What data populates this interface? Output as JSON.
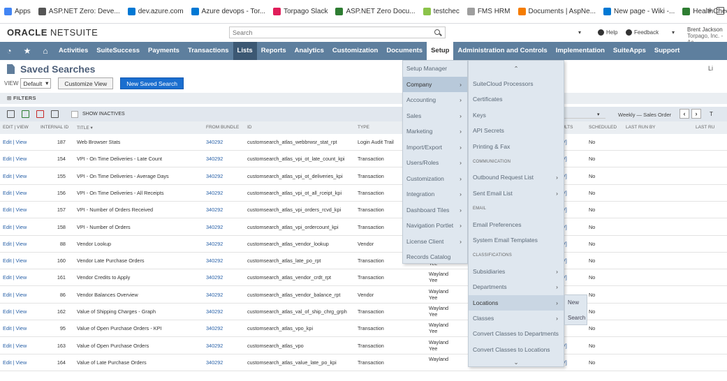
{
  "bookmarks": {
    "items": [
      {
        "label": "Apps",
        "color": "#4285f4"
      },
      {
        "label": "ASP.NET Zero: Deve...",
        "color": "#555555"
      },
      {
        "label": "dev.azure.com",
        "color": "#0078d4"
      },
      {
        "label": "Azure devops - Tor...",
        "color": "#0078d4"
      },
      {
        "label": "Torpago Slack",
        "color": "#e01e5a"
      },
      {
        "label": "ASP.NET Zero Docu...",
        "color": "#2e7d32"
      },
      {
        "label": "testchec",
        "color": "#8bc34a"
      },
      {
        "label": "FMS HRM",
        "color": "#9e9e9e"
      },
      {
        "label": "Documents | AspNe...",
        "color": "#f57c00"
      },
      {
        "label": "New page - Wiki -...",
        "color": "#0078d4"
      },
      {
        "label": "HealthChecks | ASP....",
        "color": "#2e7d32"
      }
    ],
    "more": "»"
  },
  "header": {
    "logo_bold": "ORACLE",
    "logo_light": " NETSUITE",
    "search_placeholder": "Search",
    "help": "Help",
    "feedback": "Feedback",
    "user_name": "Brent Jackson",
    "user_company": "Torpago, Inc. - Ac"
  },
  "nav": {
    "items": [
      "Activities",
      "SuiteSuccess",
      "Payments",
      "Transactions",
      "Lists",
      "Reports",
      "Analytics",
      "Customization",
      "Documents",
      "Setup",
      "Administration and Controls",
      "Implementation",
      "SuiteApps",
      "Support"
    ],
    "active": "Lists",
    "open": "Setup"
  },
  "page": {
    "title": "Saved Searches",
    "right_tab": "Li"
  },
  "toolbar": {
    "view_label": "VIEW",
    "view_value": "Default",
    "customize_label": "Customize View",
    "new_label": "New Saved Search"
  },
  "filters": {
    "label": "FILTERS"
  },
  "iconbar": {
    "show_inactives": "SHOW INACTIVES",
    "sort_text": "Weekly — Sales Order",
    "prev": "‹",
    "next": "›",
    "t": "T"
  },
  "table": {
    "headers": {
      "edit": "EDIT | VIEW",
      "id": "INTERNAL ID",
      "title": "TITLE ▾",
      "bundle": "FROM BUNDLE",
      "script": "ID",
      "type": "TYPE",
      "results": "SULTS",
      "scheduled": "SCHEDULED",
      "last_run_by": "LAST RUN BY",
      "last_run": "LAST RU"
    },
    "rows": [
      {
        "edit": "Edit | View",
        "id": "187",
        "title": "Web Browser Stats",
        "bundle": "340292",
        "script": "customsearch_atlas_webbrwsr_stat_rpt",
        "type": "Login Audit Trail",
        "owner": "",
        "owner2": "",
        "res": "SV]",
        "sch": "No"
      },
      {
        "edit": "Edit | View",
        "id": "154",
        "title": "VPI - On Time Deliveries - Late Count",
        "bundle": "340292",
        "script": "customsearch_atlas_vpi_ot_late_count_kpi",
        "type": "Transaction",
        "owner": "",
        "owner2": "",
        "res": "SV]",
        "sch": "No"
      },
      {
        "edit": "Edit | View",
        "id": "155",
        "title": "VPI - On Time Deliveries - Average Days",
        "bundle": "340292",
        "script": "customsearch_atlas_vpi_ot_deliveries_kpi",
        "type": "Transaction",
        "owner": "",
        "owner2": "",
        "res": "SV]",
        "sch": "No"
      },
      {
        "edit": "Edit | View",
        "id": "156",
        "title": "VPI - On Time Deliveries - All Receipts",
        "bundle": "340292",
        "script": "customsearch_atlas_vpi_ot_all_rceipt_kpi",
        "type": "Transaction",
        "owner": "",
        "owner2": "",
        "res": "SV]",
        "sch": "No"
      },
      {
        "edit": "Edit | View",
        "id": "157",
        "title": "VPI - Number of Orders Received",
        "bundle": "340292",
        "script": "customsearch_atlas_vpi_orders_rcvd_kpi",
        "type": "Transaction",
        "owner": "",
        "owner2": "",
        "res": "SV]",
        "sch": "No"
      },
      {
        "edit": "Edit | View",
        "id": "158",
        "title": "VPI - Number of Orders",
        "bundle": "340292",
        "script": "customsearch_atlas_vpi_ordercount_kpi",
        "type": "Transaction",
        "owner": "",
        "owner2": "",
        "res": "SV]",
        "sch": "No"
      },
      {
        "edit": "Edit | View",
        "id": "88",
        "title": "Vendor Lookup",
        "bundle": "340292",
        "script": "customsearch_atlas_vendor_lookup",
        "type": "Vendor",
        "owner": "",
        "owner2": "",
        "res": "SV]",
        "sch": "No"
      },
      {
        "edit": "Edit | View",
        "id": "160",
        "title": "Vendor Late Purchase Orders",
        "bundle": "340292",
        "script": "customsearch_atlas_late_po_rpt",
        "type": "Transaction",
        "owner": "",
        "owner2": "Yee",
        "res": "SV]",
        "sch": "No"
      },
      {
        "edit": "Edit | View",
        "id": "161",
        "title": "Vendor Credits to Apply",
        "bundle": "340292",
        "script": "customsearch_atlas_vendor_crdt_rpt",
        "type": "Transaction",
        "owner": "Wayland",
        "owner2": "Yee",
        "res": "SV]",
        "sch": "No"
      },
      {
        "edit": "Edit | View",
        "id": "86",
        "title": "Vendor Balances Overview",
        "bundle": "340292",
        "script": "customsearch_atlas_vendor_balance_rpt",
        "type": "Vendor",
        "owner": "Wayland",
        "owner2": "Yee",
        "res": "",
        "sch": "No"
      },
      {
        "edit": "Edit | View",
        "id": "162",
        "title": "Value of Shipping Charges - Graph",
        "bundle": "340292",
        "script": "customsearch_atlas_val_of_ship_chrg_grph",
        "type": "Transaction",
        "owner": "Wayland",
        "owner2": "Yee",
        "res": "",
        "sch": "No"
      },
      {
        "edit": "Edit | View",
        "id": "95",
        "title": "Value of Open Purchase Orders - KPI",
        "bundle": "340292",
        "script": "customsearch_atlas_vpo_kpi",
        "type": "Transaction",
        "owner": "Wayland",
        "owner2": "Yee",
        "res": "",
        "sch": "No"
      },
      {
        "edit": "Edit | View",
        "id": "163",
        "title": "Value of Open Purchase Orders",
        "bundle": "340292",
        "script": "customsearch_atlas_vpo",
        "type": "Transaction",
        "owner": "Wayland",
        "owner2": "Yee",
        "res": "SV]",
        "sch": "No"
      },
      {
        "edit": "Edit | View",
        "id": "164",
        "title": "Value of Late Purchase Orders",
        "bundle": "340292",
        "script": "customsearch_atlas_value_late_po_kpi",
        "type": "Transaction",
        "owner": "Wayland",
        "owner2": "",
        "res": "SV]",
        "sch": "No"
      }
    ]
  },
  "setup_menu": {
    "items": [
      {
        "label": "Setup Manager",
        "arrow": ""
      },
      {
        "label": "Company",
        "arrow": "›"
      },
      {
        "label": "Accounting",
        "arrow": "›"
      },
      {
        "label": "Sales",
        "arrow": "›"
      },
      {
        "label": "Marketing",
        "arrow": "›"
      },
      {
        "label": "Import/Export",
        "arrow": "›"
      },
      {
        "label": "Users/Roles",
        "arrow": "›"
      },
      {
        "label": "Customization",
        "arrow": "›"
      },
      {
        "label": "Integration",
        "arrow": "›"
      },
      {
        "label": "Dashboard Tiles",
        "arrow": "›"
      },
      {
        "label": "Navigation Portlet",
        "arrow": "›"
      },
      {
        "label": "License Client",
        "arrow": "›"
      },
      {
        "label": "Records Catalog",
        "arrow": ""
      }
    ],
    "highlight": "Company"
  },
  "company_menu": {
    "up": "⌃",
    "down": "⌄",
    "items": [
      {
        "label": "SuiteCloud Processors",
        "arrow": "",
        "sec": false
      },
      {
        "label": "Certificates",
        "arrow": "",
        "sec": false
      },
      {
        "label": "Keys",
        "arrow": "",
        "sec": false
      },
      {
        "label": "API Secrets",
        "arrow": "",
        "sec": false
      },
      {
        "label": "Printing & Fax",
        "arrow": "",
        "sec": false
      },
      {
        "label": "COMMUNICATION",
        "arrow": "",
        "sec": true
      },
      {
        "label": "Outbound Request List",
        "arrow": "›",
        "sec": false
      },
      {
        "label": "Sent Email List",
        "arrow": "›",
        "sec": false
      },
      {
        "label": "EMAIL",
        "arrow": "",
        "sec": true
      },
      {
        "label": "Email Preferences",
        "arrow": "",
        "sec": false
      },
      {
        "label": "System Email Templates",
        "arrow": "",
        "sec": false
      },
      {
        "label": "CLASSIFICATIONS",
        "arrow": "",
        "sec": true
      },
      {
        "label": "Subsidiaries",
        "arrow": "›",
        "sec": false
      },
      {
        "label": "Departments",
        "arrow": "›",
        "sec": false
      },
      {
        "label": "Locations",
        "arrow": "›",
        "sec": false
      },
      {
        "label": "Classes",
        "arrow": "›",
        "sec": false
      },
      {
        "label": "Convert Classes to Departments",
        "arrow": "",
        "sec": false
      },
      {
        "label": "Convert Classes to Locations",
        "arrow": "",
        "sec": false
      }
    ],
    "highlight": "Locations"
  },
  "locations_menu": {
    "items": [
      "New",
      "Search"
    ]
  }
}
